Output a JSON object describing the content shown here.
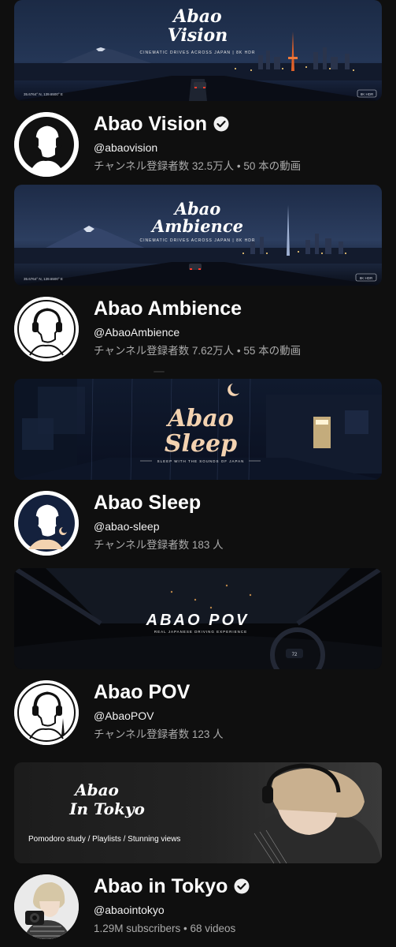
{
  "channels": [
    {
      "banner": {
        "title_line1": "Abao",
        "title_line2": "Vision",
        "subtitle": "CINEMATIC DRIVES ACROSS JAPAN  |  8K HDR",
        "coords": "35.6764° N, 139.6500° E",
        "badge": "8K HDR"
      },
      "name": "Abao Vision",
      "verified": true,
      "handle": "@abaovision",
      "stats": "チャンネル登録者数 32.5万人 • 50 本の動画"
    },
    {
      "banner": {
        "title_line1": "Abao",
        "title_line2": "Ambience",
        "subtitle": "CINEMATIC DRIVES ACROSS JAPAN  |  8K HDR",
        "coords": "35.6764° N, 139.6500° E",
        "badge": "8K HDR"
      },
      "name": "Abao Ambience",
      "verified": false,
      "handle": "@AbaoAmbience",
      "stats": "チャンネル登録者数 7.62万人 • 55 本の動画"
    },
    {
      "banner": {
        "title_line1": "Abao",
        "title_line2": "Sleep",
        "subtitle": "SLEEP WITH THE SOUNDS OF JAPAN"
      },
      "name": "Abao Sleep",
      "verified": false,
      "handle": "@abao-sleep",
      "stats": "チャンネル登録者数 183 人"
    },
    {
      "banner": {
        "title": "ABAO POV",
        "subtitle": "REAL JAPANESE DRIVING EXPERIENCE",
        "speed": "72"
      },
      "name": "Abao POV",
      "verified": false,
      "handle": "@AbaoPOV",
      "stats": "チャンネル登録者数 123 人"
    },
    {
      "banner": {
        "title_line1": "Abao",
        "title_line2": "In Tokyo",
        "tagline": "Pomodoro study / Playlists / Stunning views"
      },
      "name": "Abao in Tokyo",
      "verified": true,
      "handle": "@abaointokyo",
      "stats": "1.29M subscribers • 68 videos"
    }
  ],
  "colors": {
    "background": "#0f0f0f",
    "secondary_text": "#aaaaaa",
    "tower_orange": "#e0612a",
    "sleep_title": "#f3d2b0"
  }
}
